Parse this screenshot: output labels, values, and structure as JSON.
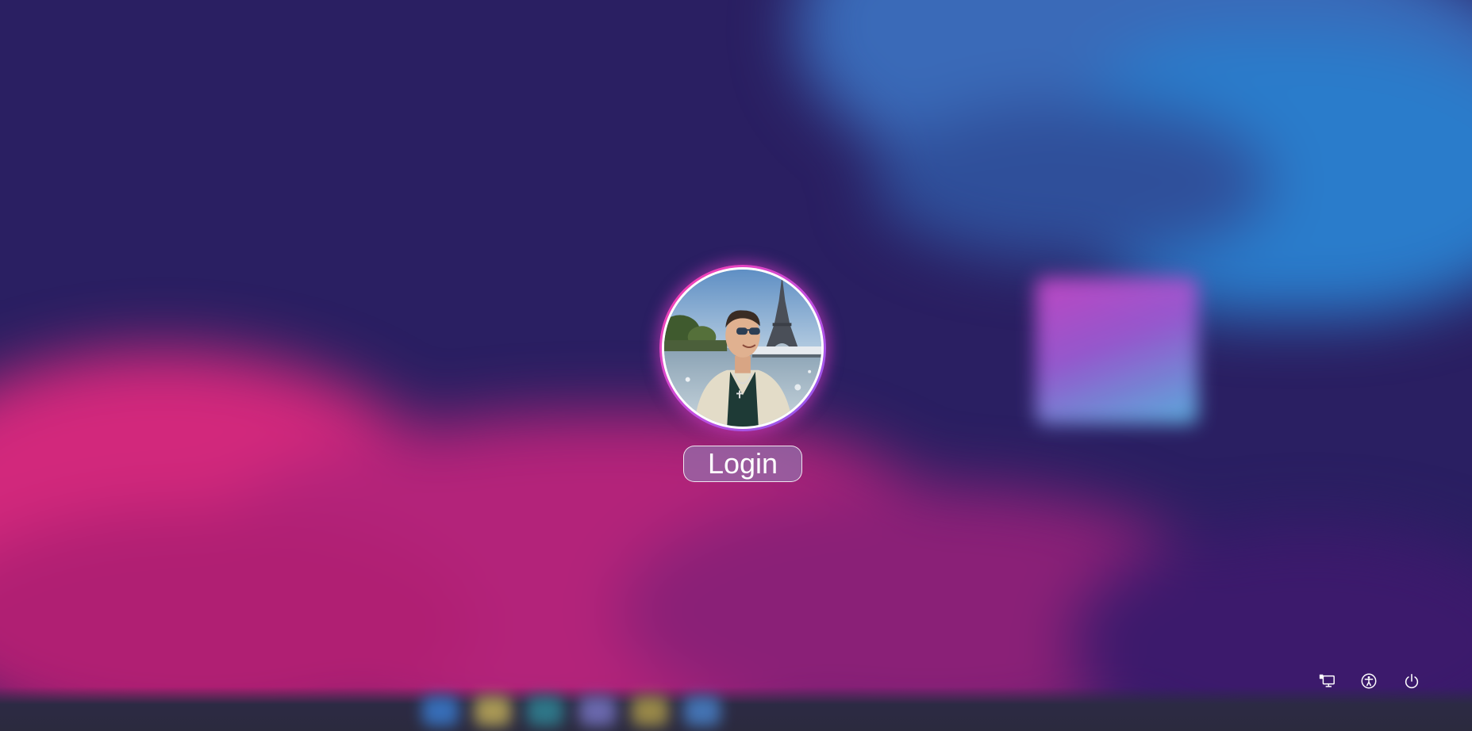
{
  "screen": {
    "type": "lock-screen",
    "accent_ring_colors": [
      "#ff3ca8",
      "#c34ee0",
      "#8a5cf0"
    ]
  },
  "user": {
    "avatar": "user-photo",
    "login_label": "Login"
  },
  "system_buttons": [
    {
      "icon": "network-computer-icon",
      "label": ""
    },
    {
      "icon": "accessibility-icon",
      "label": ""
    },
    {
      "icon": "power-icon",
      "label": ""
    }
  ]
}
